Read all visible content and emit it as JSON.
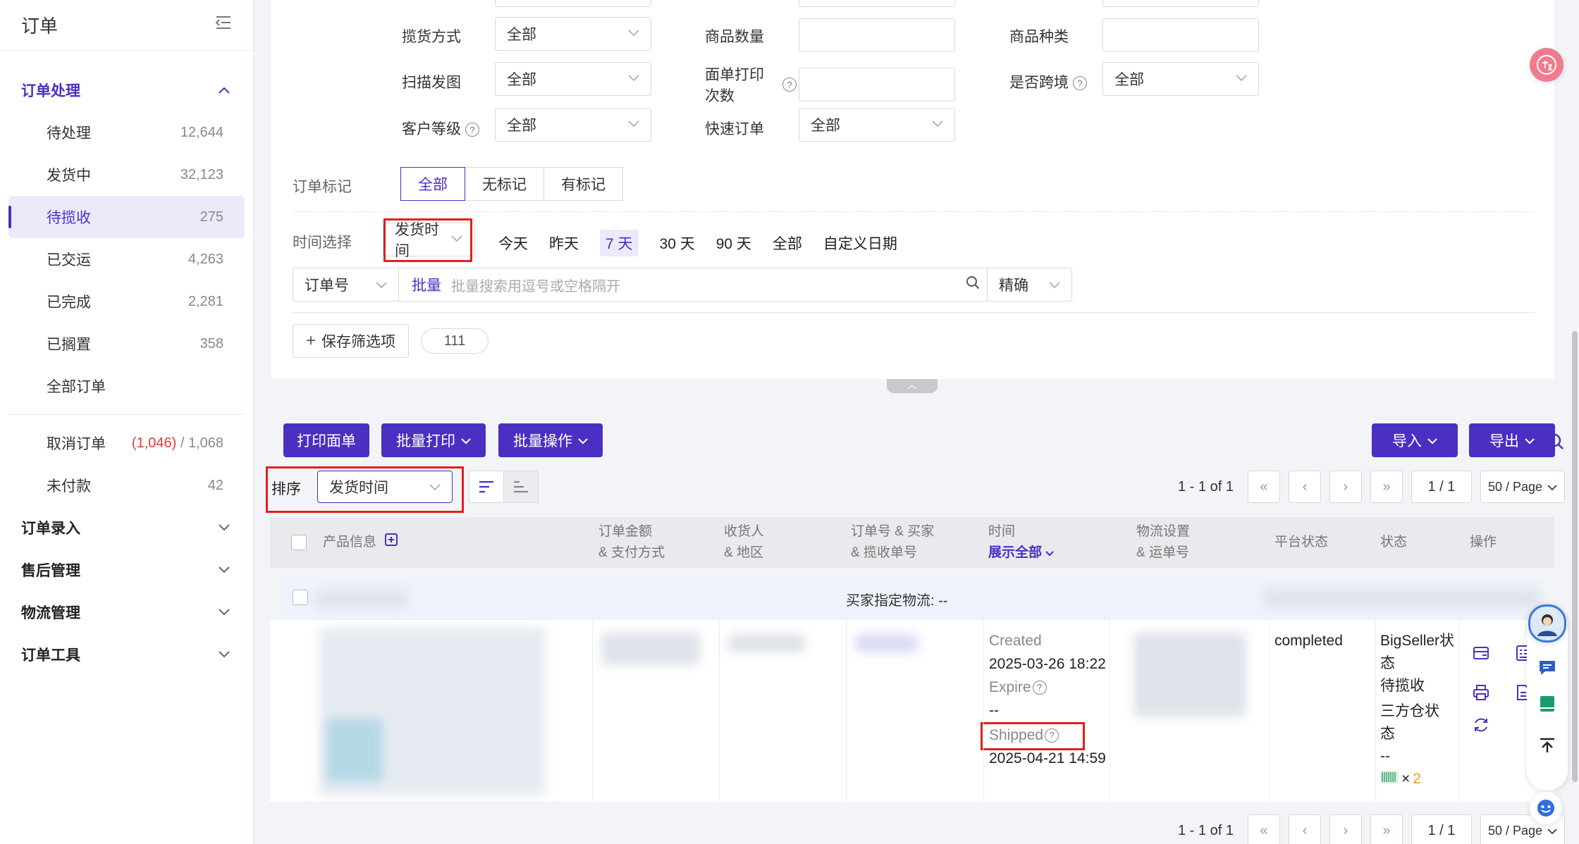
{
  "sidebar": {
    "title": "订单",
    "groups": [
      {
        "label": "订单处理",
        "expanded": true
      },
      {
        "label": "订单录入"
      },
      {
        "label": "售后管理"
      },
      {
        "label": "物流管理"
      },
      {
        "label": "订单工具"
      }
    ],
    "items": [
      {
        "label": "待处理",
        "count": "12,644"
      },
      {
        "label": "发货中",
        "count": "32,123"
      },
      {
        "label": "待揽收",
        "count": "275"
      },
      {
        "label": "已交运",
        "count": "4,263"
      },
      {
        "label": "已完成",
        "count": "2,281"
      },
      {
        "label": "已搁置",
        "count": "358"
      },
      {
        "label": "全部订单",
        "count": ""
      },
      {
        "label": "取消订单",
        "count_red": "(1,046)",
        "count_rest": " / 1,068"
      },
      {
        "label": "未付款",
        "count": "42"
      }
    ]
  },
  "filters": {
    "pickup_method": {
      "label": "揽货方式",
      "value": "全部"
    },
    "item_qty": {
      "label": "商品数量",
      "value": ""
    },
    "item_types": {
      "label": "商品种类",
      "value": ""
    },
    "scan_ship": {
      "label": "扫描发图",
      "value": "全部"
    },
    "print_count": {
      "label_1": "面单打印",
      "label_2": "次数",
      "value": ""
    },
    "cross_border": {
      "label": "是否跨境",
      "value": "全部"
    },
    "customer_level": {
      "label": "客户等级",
      "value": "全部"
    },
    "express": {
      "label": "快速订单",
      "value": "全部"
    },
    "order_mark": {
      "label": "订单标记",
      "options": [
        "全部",
        "无标记",
        "有标记"
      ],
      "selected": "全部"
    },
    "time": {
      "label": "时间选择",
      "field": "发货时间",
      "options": [
        "今天",
        "昨天",
        "7 天",
        "30 天",
        "90 天",
        "全部",
        "自定义日期"
      ],
      "selected": "7 天"
    },
    "search": {
      "field": "订单号",
      "batch": "批量",
      "placeholder": "批量搜索用逗号或空格隔开",
      "mode": "精确"
    },
    "save_label": "保存筛选项",
    "saved_pill": "111"
  },
  "toolbar": {
    "print_label": "打印面单",
    "batch_print": "批量打印",
    "batch_ops": "批量操作",
    "import": "导入",
    "export": "导出",
    "sort_label": "排序",
    "sort_value": "发货时间"
  },
  "pagination": {
    "summary": "1 - 1 of 1",
    "page": "1 / 1",
    "page_size": "50 / Page"
  },
  "table": {
    "headers": {
      "product": "产品信息",
      "amount_1": "订单金额",
      "amount_2": "& 支付方式",
      "receiver_1": "收货人",
      "receiver_2": "& 地区",
      "order_1": "订单号 & 买家",
      "order_2": "& 揽收单号",
      "time_1": "时间",
      "time_2": "展示全部",
      "logistics_1": "物流设置",
      "logistics_2": "& 运单号",
      "platform_status": "平台状态",
      "status": "状态",
      "actions": "操作"
    },
    "row": {
      "buyer_logistics": "买家指定物流: --",
      "time": {
        "created_label": "Created",
        "created": "2025-03-26 18:22",
        "expire_label": "Expire",
        "expire": "--",
        "shipped_label": "Shipped",
        "shipped": "2025-04-21 14:59"
      },
      "platform_status": "completed",
      "status": {
        "bs_1": "BigSeller状",
        "bs_2": "态",
        "bs_value": "待揽收",
        "wh_1": "三方仓状",
        "wh_2": "态",
        "wh_value": "--",
        "qty_sign": "×",
        "qty": "2"
      }
    }
  },
  "colors": {
    "accent": "#4b2fc2",
    "highlight_box": "#e02020",
    "count_red": "#e53935",
    "qty_orange": "#f0a020"
  }
}
